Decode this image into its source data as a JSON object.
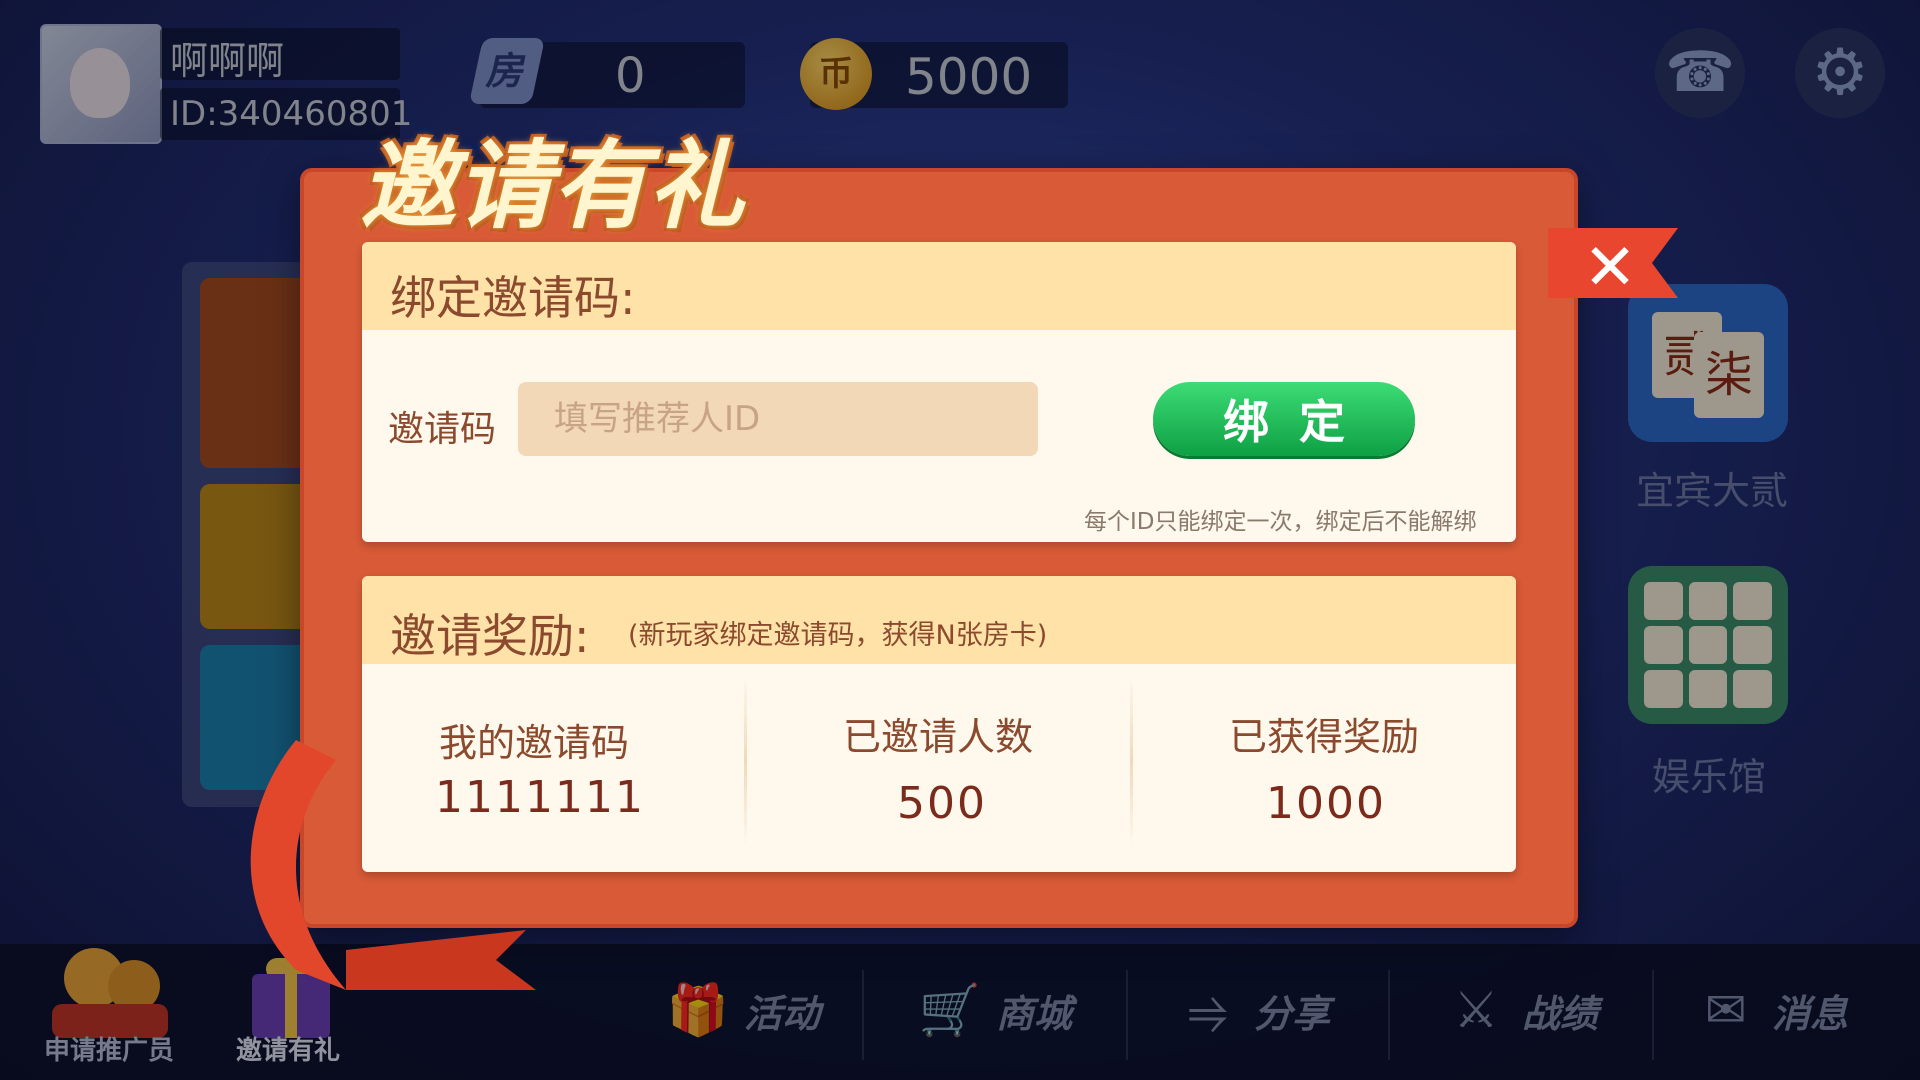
{
  "user": {
    "name": "啊啊啊",
    "id_text": "ID:340460801"
  },
  "resources": {
    "room_icon_label": "房",
    "room_cards": "0",
    "coin_icon_label": "币",
    "coins": "5000"
  },
  "icons": {
    "support": "headset-icon",
    "settings": "gear-icon",
    "close": "close-icon"
  },
  "games": {
    "yibin": {
      "label": "宜宾大贰",
      "tile_chars": [
        "贰",
        "柒"
      ]
    },
    "yule": {
      "label": "娱乐馆"
    }
  },
  "dialog": {
    "title": "邀请有礼",
    "bind_section": {
      "heading": "绑定邀请码:",
      "field_label": "邀请码",
      "placeholder": "填写推荐人ID",
      "button_label": "绑定",
      "note": "每个ID只能绑定一次，绑定后不能解绑"
    },
    "reward_section": {
      "heading": "邀请奖励:",
      "subheading": "(新玩家绑定邀请码，获得N张房卡)",
      "columns": [
        {
          "label": "我的邀请码",
          "value": "1111111"
        },
        {
          "label": "已邀请人数",
          "value": "500"
        },
        {
          "label": "已获得奖励",
          "value": "1000"
        }
      ]
    }
  },
  "bottom_nav": {
    "promoter": "申请推广员",
    "invite": "邀请有礼",
    "items": [
      {
        "label": "活动",
        "icon": "gift-icon"
      },
      {
        "label": "商城",
        "icon": "cart-icon"
      },
      {
        "label": "分享",
        "icon": "share-icon"
      },
      {
        "label": "战绩",
        "icon": "crossed-swords-icon"
      },
      {
        "label": "消息",
        "icon": "mail-icon"
      }
    ]
  },
  "colors": {
    "modal_bg": "#d85a37",
    "panel_header": "#ffe2a8",
    "bind_button": "#16b552",
    "text_brown": "#8b4a2e"
  }
}
